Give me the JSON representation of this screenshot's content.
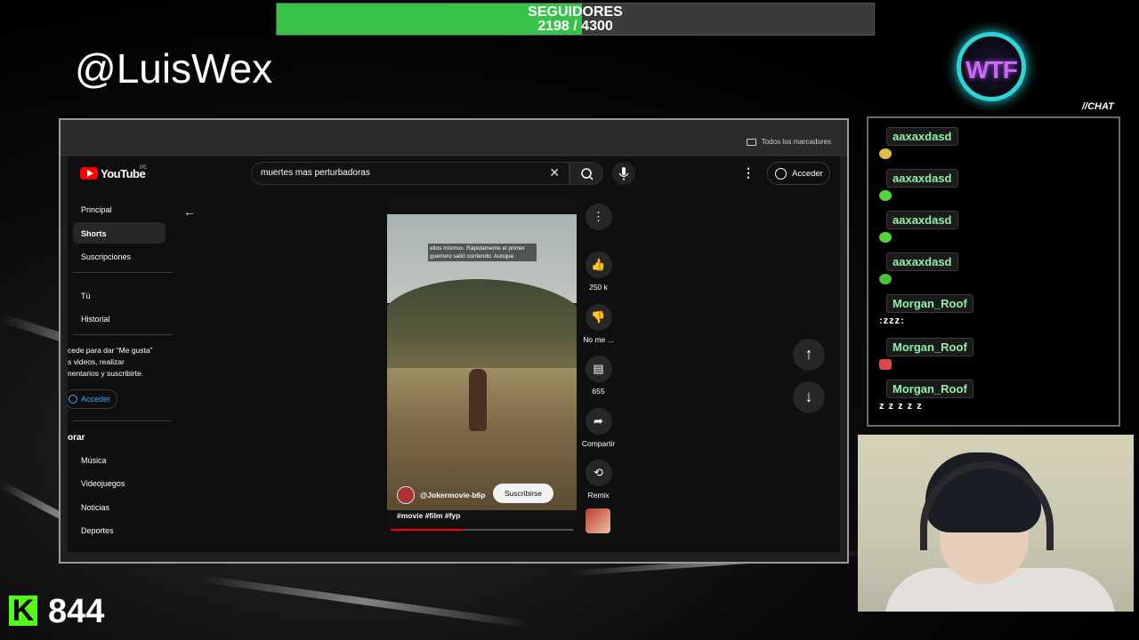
{
  "followers": {
    "label": "SEGUIDORES",
    "current": "2198",
    "separator": "/",
    "goal": "4300",
    "progress": 0.511,
    "fill_color": "#37c24a"
  },
  "streamer_handle": "@LuisWex",
  "logo": {
    "text": "WTF",
    "ring_color": "#2ed3d8",
    "text_color": "#c56cf0"
  },
  "chat": {
    "title": "//CHAT",
    "messages": [
      {
        "user": "aaxaxdasd",
        "emote": "emote-smile",
        "emote_color": "#e0c040"
      },
      {
        "user": "aaxaxdasd",
        "emote": "emote-green",
        "emote_color": "#53d63a"
      },
      {
        "user": "aaxaxdasd",
        "emote": "emote-green",
        "emote_color": "#53d63a"
      },
      {
        "user": "aaxaxdasd",
        "emote": "emote-green-blob",
        "emote_color": "#49c43a"
      },
      {
        "user": "Morgan_Roof",
        "text": ":zzz:"
      },
      {
        "user": "Morgan_Roof",
        "emote": "emote-red-devil",
        "emote_color": "#d9484d"
      },
      {
        "user": "Morgan_Roof",
        "text": "z z z z z"
      }
    ],
    "username_color": "#8ff0a4"
  },
  "kick": {
    "logo": "K",
    "viewer_count": "844",
    "brand_color": "#53fc18"
  },
  "browser": {
    "bookmarks_label": "Todos los marcadores",
    "youtube": {
      "logo_text": "YouTube",
      "region": "PE",
      "search_value": "muertes mas perturbadoras",
      "clear_icon": "close-icon",
      "search_icon": "search-icon",
      "mic_icon": "mic-icon",
      "more_icon": "more-vert-icon",
      "signin_label": "Acceder",
      "sidebar": {
        "items": [
          {
            "label": "Principal",
            "active": false
          },
          {
            "label": "Shorts",
            "active": true
          },
          {
            "label": "Suscripciones",
            "active": false
          },
          {
            "label": "Tú",
            "active": false
          },
          {
            "label": "Historial",
            "active": false
          }
        ],
        "promo_lines": [
          "cede para dar “Me gusta”",
          "s videos, realizar",
          "nentarios y suscribirte."
        ],
        "signin_label": "Acceder",
        "section_title": "orar",
        "explore_items": [
          "Música",
          "Videojuegos",
          "Noticias",
          "Deportes"
        ]
      },
      "short": {
        "caption": "ellos mismos. Rápidamente el primer guerrero salió corriendo. Aunque",
        "channel": "@Jokermovie-b6p",
        "subscribe_label": "Suscribirse",
        "hashtags": "#movie #film #fyp",
        "progress": 0.4,
        "progress_color": "#ff0000"
      },
      "actions": {
        "like_count": "250 k",
        "dislike_label": "No me ...",
        "comment_count": "655",
        "share_label": "Compartir",
        "remix_label": "Remix"
      }
    }
  }
}
